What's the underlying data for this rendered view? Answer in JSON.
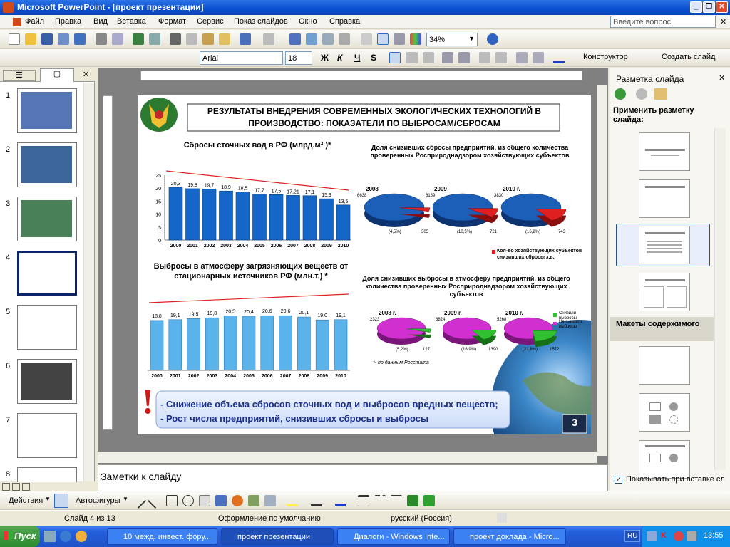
{
  "window": {
    "title": "Microsoft PowerPoint - [проект презентации]",
    "ask": "Введите вопрос"
  },
  "menu": [
    "Файл",
    "Правка",
    "Вид",
    "Вставка",
    "Формат",
    "Сервис",
    "Показ слайдов",
    "Окно",
    "Справка"
  ],
  "toolbar": {
    "zoom": "34%",
    "font": "Arial",
    "size": "18",
    "bold": "Ж",
    "italic": "К",
    "underline": "Ч",
    "shadow": "S",
    "designer": "Конструктор",
    "new_slide": "Создать слайд"
  },
  "slides": [
    "1",
    "2",
    "3",
    "4",
    "5",
    "6",
    "7",
    "8"
  ],
  "slide": {
    "title": "РЕЗУЛЬТАТЫ ВНЕДРЕНИЯ СОВРЕМЕННЫХ ЭКОЛОГИЧЕСКИХ ТЕХНОЛОГИЙ В ПРОИЗВОДСТВО: ПОКАЗАТЕЛИ ПО ВЫБРОСАМ/СБРОСАМ",
    "chart1_title": "Сбросы сточных вод в РФ (млрд.м³ )*",
    "chart2_title": "Выбросы в атмосферу загрязняющих веществ от стационарных источников РФ (млн.т.) *",
    "pie1_title": "Доля снизивших сбросы предприятий, из общего количества проверенных Росприроднадзором хозяйствующих субъектов",
    "pie2_title": "Доля снизивших выбросы в атмосферу предприятий, из общего количества проверенных Росприроднадзором хозяйствующих субъектов",
    "pie1_legend": "Кол-во хозяйствующих субъектов снизивших сбросы з.в.",
    "pie2_legend_a": "Снизили выбросы",
    "pie2_legend_b": "Не снизили выбросы",
    "source_note": "*- по данным Росстата",
    "conclusion_1": "- Снижение объема сбросов сточных вод и выбросов вредных веществ;",
    "conclusion_2": "- Рост числа предприятий, снизивших сбросы и выбросы",
    "exclaim": "!",
    "page_num": "3"
  },
  "chart_data": [
    {
      "type": "bar",
      "title": "Сбросы сточных вод в РФ (млрд.м³ )*",
      "categories": [
        "2000",
        "2001",
        "2002",
        "2003",
        "2004",
        "2005",
        "2006",
        "2007",
        "2008",
        "2009",
        "2010"
      ],
      "values": [
        20.3,
        19.8,
        19.7,
        18.9,
        18.5,
        17.7,
        17.5,
        17.21,
        17.1,
        15.9,
        13.5
      ],
      "labels": [
        "20,3",
        "19,8",
        "19,7",
        "18,9",
        "18,5",
        "17,7",
        "17,5",
        "17,21",
        "17,1",
        "15,9",
        "13,5"
      ],
      "ylim": [
        0,
        25
      ],
      "yticks": [
        "0",
        "5",
        "10",
        "15",
        "20",
        "25"
      ],
      "color": "#1466c8"
    },
    {
      "type": "bar",
      "title": "Выбросы в атмосферу загрязняющих веществ от стационарных источников РФ (млн.т.) *",
      "categories": [
        "2000",
        "2001",
        "2002",
        "2003",
        "2004",
        "2005",
        "2006",
        "2007",
        "2008",
        "2009",
        "2010"
      ],
      "values": [
        18.8,
        19.1,
        19.5,
        19.8,
        20.5,
        20.4,
        20.6,
        20.6,
        20.1,
        19.0,
        19.1
      ],
      "labels": [
        "18,8",
        "19,1",
        "19,5",
        "19,8",
        "20,5",
        "20,4",
        "20,6",
        "20,6",
        "20,1",
        "19,0",
        "19,1"
      ],
      "ylim": [
        0,
        22
      ],
      "color": "#5bb3ec"
    },
    {
      "type": "pie",
      "series": [
        {
          "name": "2008",
          "values": [
            6638,
            305
          ],
          "labels": [
            "6638",
            "305"
          ],
          "pct_label": "(4,5%)"
        },
        {
          "name": "2009",
          "values": [
            6169,
            721
          ],
          "labels": [
            "6169",
            "721"
          ],
          "pct_label": "(10,5%)"
        },
        {
          "name": "2010 г.",
          "values": [
            3830,
            743
          ],
          "labels": [
            "3830",
            "743"
          ],
          "pct_label": "(16,2%)"
        }
      ]
    },
    {
      "type": "pie",
      "series": [
        {
          "name": "2008 г.",
          "values": [
            2323,
            127
          ],
          "labels": [
            "2323",
            "127"
          ],
          "pct_label": "(5,2%)"
        },
        {
          "name": "2009 г.",
          "values": [
            6824,
            1390
          ],
          "labels": [
            "6824",
            "1390"
          ],
          "pct_label": "(16,9%)"
        },
        {
          "name": "2010 г.",
          "values": [
            5268,
            1572
          ],
          "labels": [
            "5268",
            "1572"
          ],
          "pct_label": "(21,8%)"
        }
      ]
    }
  ],
  "right_panel": {
    "title": "Разметка слайда",
    "apply": "Применить разметку слайда:",
    "section": "Макеты содержимого",
    "checkbox": "Показывать при вставке сл"
  },
  "notes": "Заметки к слайду",
  "drawbar": {
    "actions": "Действия",
    "autoshapes": "Автофигуры"
  },
  "status": {
    "slide": "Слайд 4 из 13",
    "design": "Оформление по умолчанию",
    "lang": "русский (Россия)"
  },
  "taskbar": {
    "start": "Пуск",
    "tasks": [
      "10 межд. инвест. фору...",
      "проект презентации",
      "Диалоги - Windows Inte...",
      "проект доклада - Micro..."
    ],
    "lang": "RU",
    "clock": "13:55"
  }
}
